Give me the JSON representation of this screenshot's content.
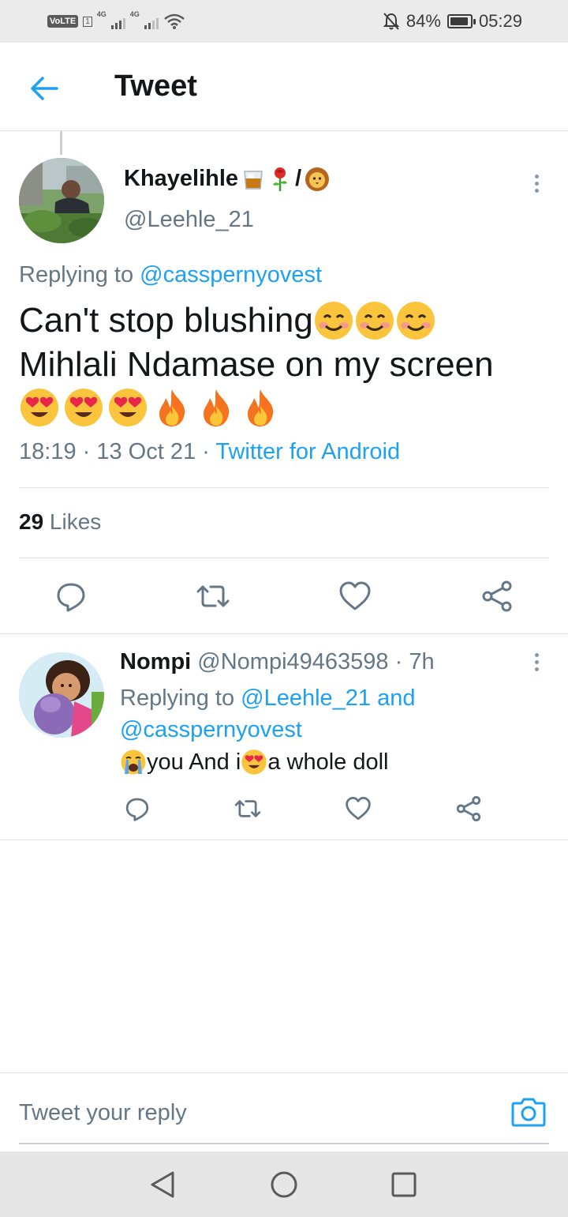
{
  "status_bar": {
    "volte": "VoLTE",
    "sim": "1",
    "net1": "4G",
    "net2": "4G",
    "battery_pct": "84%",
    "time": "05:29"
  },
  "header": {
    "title": "Tweet"
  },
  "main_tweet": {
    "author_name": "Khayelihle",
    "author_separator": "/",
    "handle": "@Leehle_21",
    "replying_prefix": "Replying to ",
    "replying_to": "@casspernyovest",
    "text_line1": "Can't stop blushing",
    "text_line2": "Mihlali Ndamase on my screen",
    "time": "18:19",
    "dot1": " · ",
    "date": "13 Oct 21",
    "dot2": " · ",
    "source": "Twitter for Android",
    "likes_count": "29",
    "likes_label": " Likes"
  },
  "reply": {
    "author_name": "Nompi",
    "handle": " @Nompi49463598",
    "dot": " · ",
    "age": "7h",
    "replying_prefix": "Replying to ",
    "replying_to_1": "@Leehle_21",
    "replying_and": " and ",
    "replying_to_2": "@casspernyovest",
    "text_1": "you And i",
    "text_2": "a whole doll"
  },
  "compose": {
    "placeholder": "Tweet your reply"
  },
  "colors": {
    "accent": "#1da1f2",
    "secondary_text": "#657786",
    "primary_text": "#14171a"
  },
  "icons": [
    "back-arrow-icon",
    "more-vertical-icon",
    "reply-icon",
    "retweet-icon",
    "like-icon",
    "share-icon",
    "camera-icon",
    "nav-back-icon",
    "nav-home-icon",
    "nav-recents-icon"
  ]
}
